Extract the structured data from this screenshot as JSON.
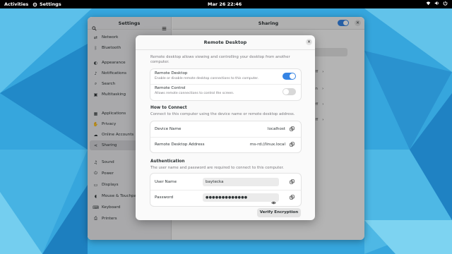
{
  "topbar": {
    "activities": "Activities",
    "app_name": "Settings",
    "clock": "Mar 26  22:46",
    "status_icons": [
      "network-icon",
      "volume-icon",
      "power-icon"
    ]
  },
  "settings": {
    "title": "Settings",
    "content_title": "Sharing",
    "sidebar": [
      {
        "label": "Network",
        "icon": "network-icon"
      },
      {
        "label": "Bluetooth",
        "icon": "bluetooth-icon"
      },
      {
        "label": "Appearance",
        "icon": "appearance-icon"
      },
      {
        "label": "Notifications",
        "icon": "bell-icon"
      },
      {
        "label": "Search",
        "icon": "search-icon"
      },
      {
        "label": "Multitasking",
        "icon": "multitasking-icon"
      },
      {
        "label": "Applications",
        "icon": "apps-icon"
      },
      {
        "label": "Privacy",
        "icon": "hand-icon"
      },
      {
        "label": "Online Accounts",
        "icon": "cloud-icon"
      },
      {
        "label": "Sharing",
        "icon": "share-icon",
        "active": true
      },
      {
        "label": "Sound",
        "icon": "speaker-icon"
      },
      {
        "label": "Power",
        "icon": "power-icon"
      },
      {
        "label": "Displays",
        "icon": "display-icon"
      },
      {
        "label": "Mouse & Touchpad",
        "icon": "mouse-icon"
      },
      {
        "label": "Keyboard",
        "icon": "keyboard-icon"
      },
      {
        "label": "Printers",
        "icon": "printer-icon"
      }
    ],
    "background_rows": [
      "Off",
      "On",
      "Off",
      "Off"
    ]
  },
  "dialog": {
    "title": "Remote Desktop",
    "description": "Remote desktop allows viewing and controlling your desktop from another computer.",
    "remote_desktop": {
      "title": "Remote Desktop",
      "subtitle": "Enable or disable remote desktop connections to this computer.",
      "enabled": true
    },
    "remote_control": {
      "title": "Remote Control",
      "subtitle": "Allows remote connections to control the screen.",
      "enabled": false
    },
    "how_to_connect": {
      "heading": "How to Connect",
      "description": "Connect to this computer using the device name or remote desktop address.",
      "device_name_label": "Device Name",
      "device_name_value": "localhost",
      "address_label": "Remote Desktop Address",
      "address_value": "ms-rd://linux.local"
    },
    "authentication": {
      "heading": "Authentication",
      "description": "The user name and password are required to connect to this computer.",
      "username_label": "User Name",
      "username_value": "baytecka",
      "password_label": "Password",
      "password_value": "●●●●●●●●●●●●●"
    },
    "verify_button": "Verify Encryption"
  },
  "colors": {
    "accent": "#3584e4",
    "wallpaper": "#2f9fd8"
  }
}
